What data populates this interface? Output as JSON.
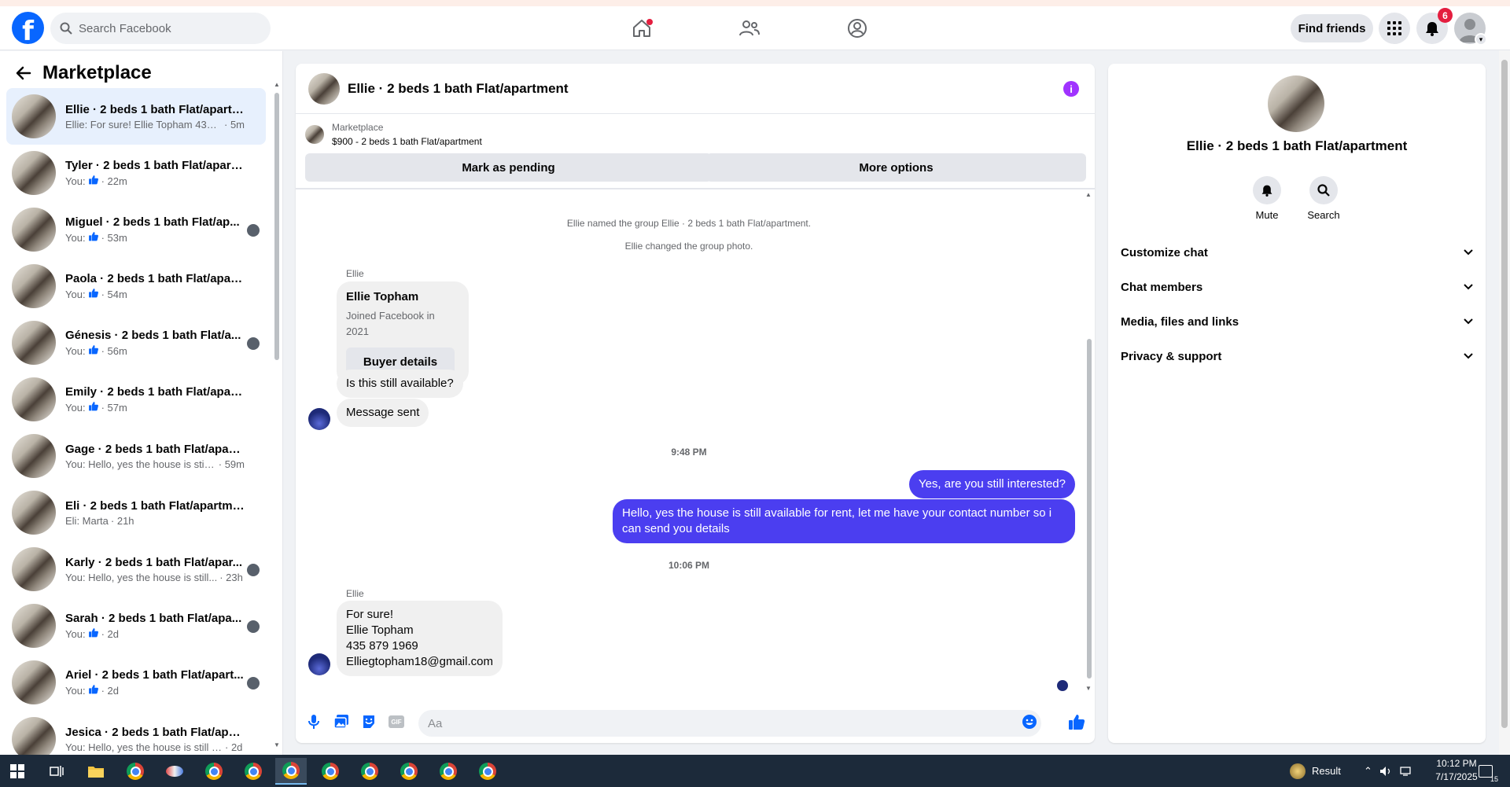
{
  "header": {
    "search_placeholder": "Search Facebook",
    "find_friends": "Find friends",
    "notifications_count": "6"
  },
  "left": {
    "title": "Marketplace",
    "conversations": [
      {
        "name": "Ellie · 2 beds 1 bath Flat/apartm...",
        "snippet": "Ellie: For sure! Ellie Topham 435 87...",
        "time": "· 5m",
        "like": false,
        "active": true,
        "seen": false
      },
      {
        "name": "Tyler · 2 beds 1 bath Flat/apartm...",
        "snippet": "You:",
        "time": "· 22m",
        "like": true,
        "active": false,
        "seen": false
      },
      {
        "name": "Miguel · 2 beds 1 bath Flat/ap...",
        "snippet": "You:",
        "time": "· 53m",
        "like": true,
        "active": false,
        "seen": true
      },
      {
        "name": "Paola · 2 beds 1 bath Flat/apart...",
        "snippet": "You:",
        "time": "· 54m",
        "like": true,
        "active": false,
        "seen": false
      },
      {
        "name": "Génesis · 2 beds 1 bath Flat/a...",
        "snippet": "You:",
        "time": "· 56m",
        "like": true,
        "active": false,
        "seen": true
      },
      {
        "name": "Emily · 2 beds 1 bath Flat/apart...",
        "snippet": "You:",
        "time": "· 57m",
        "like": true,
        "active": false,
        "seen": false
      },
      {
        "name": "Gage · 2 beds 1 bath Flat/apart...",
        "snippet": "You: Hello, yes the house is still a...",
        "time": "· 59m",
        "like": false,
        "active": false,
        "seen": false
      },
      {
        "name": "Eli · 2 beds 1 bath Flat/apartment",
        "snippet": "Eli: Marta",
        "time": "· 21h",
        "like": false,
        "active": false,
        "seen": false
      },
      {
        "name": "Karly · 2 beds 1 bath Flat/apar...",
        "snippet": "You: Hello, yes the house is still...",
        "time": "· 23h",
        "like": false,
        "active": false,
        "seen": true
      },
      {
        "name": "Sarah · 2 beds 1 bath Flat/apa...",
        "snippet": "You:",
        "time": "· 2d",
        "like": true,
        "active": false,
        "seen": true
      },
      {
        "name": "Ariel · 2 beds 1 bath Flat/apart...",
        "snippet": "You:",
        "time": "· 2d",
        "like": true,
        "active": false,
        "seen": true
      },
      {
        "name": "Jesica · 2 beds 1 bath Flat/apart...",
        "snippet": "You: Hello, yes the house is still ava...",
        "time": "· 2d",
        "like": false,
        "active": false,
        "seen": false
      }
    ]
  },
  "chat": {
    "title": "Ellie · 2 beds 1 bath Flat/apartment",
    "listing_label": "Marketplace",
    "listing_price_title": "$900 - 2 beds 1 bath Flat/apartment",
    "mark_pending": "Mark as pending",
    "more_options": "More options",
    "sys1": "Ellie named the group Ellie · 2 beds 1 bath Flat/apartment.",
    "sys2": "Ellie changed the group photo.",
    "sender1": "Ellie",
    "card_name": "Ellie Topham",
    "card_joined": "Joined Facebook in 2021",
    "card_button": "Buyer details",
    "msg_available": "Is this still available?",
    "msg_sent": "Message sent",
    "time1": "9:48 PM",
    "out1": "Yes, are you still interested?",
    "out2": "Hello, yes the house is still available for rent, let me have your contact number so i can send you details",
    "time2": "10:06 PM",
    "sender2": "Ellie",
    "in_lines": [
      "For sure!",
      "Ellie Topham",
      "435 879 1969",
      "Elliegtopham18@gmail.com"
    ],
    "compose_placeholder": "Aa"
  },
  "right": {
    "name": "Ellie · 2 beds 1 bath Flat/apartment",
    "mute": "Mute",
    "search": "Search",
    "sections": [
      "Customize chat",
      "Chat members",
      "Media, files and links",
      "Privacy & support"
    ]
  },
  "taskbar": {
    "result_label": "Result",
    "time": "10:12 PM",
    "date": "7/17/2025",
    "notif_count": "15"
  },
  "colors": {
    "brand": "#0866ff",
    "outgoing_bubble": "#4b3ef0",
    "info_purple": "#a033ff",
    "active_conv": "#e7f0fd"
  }
}
